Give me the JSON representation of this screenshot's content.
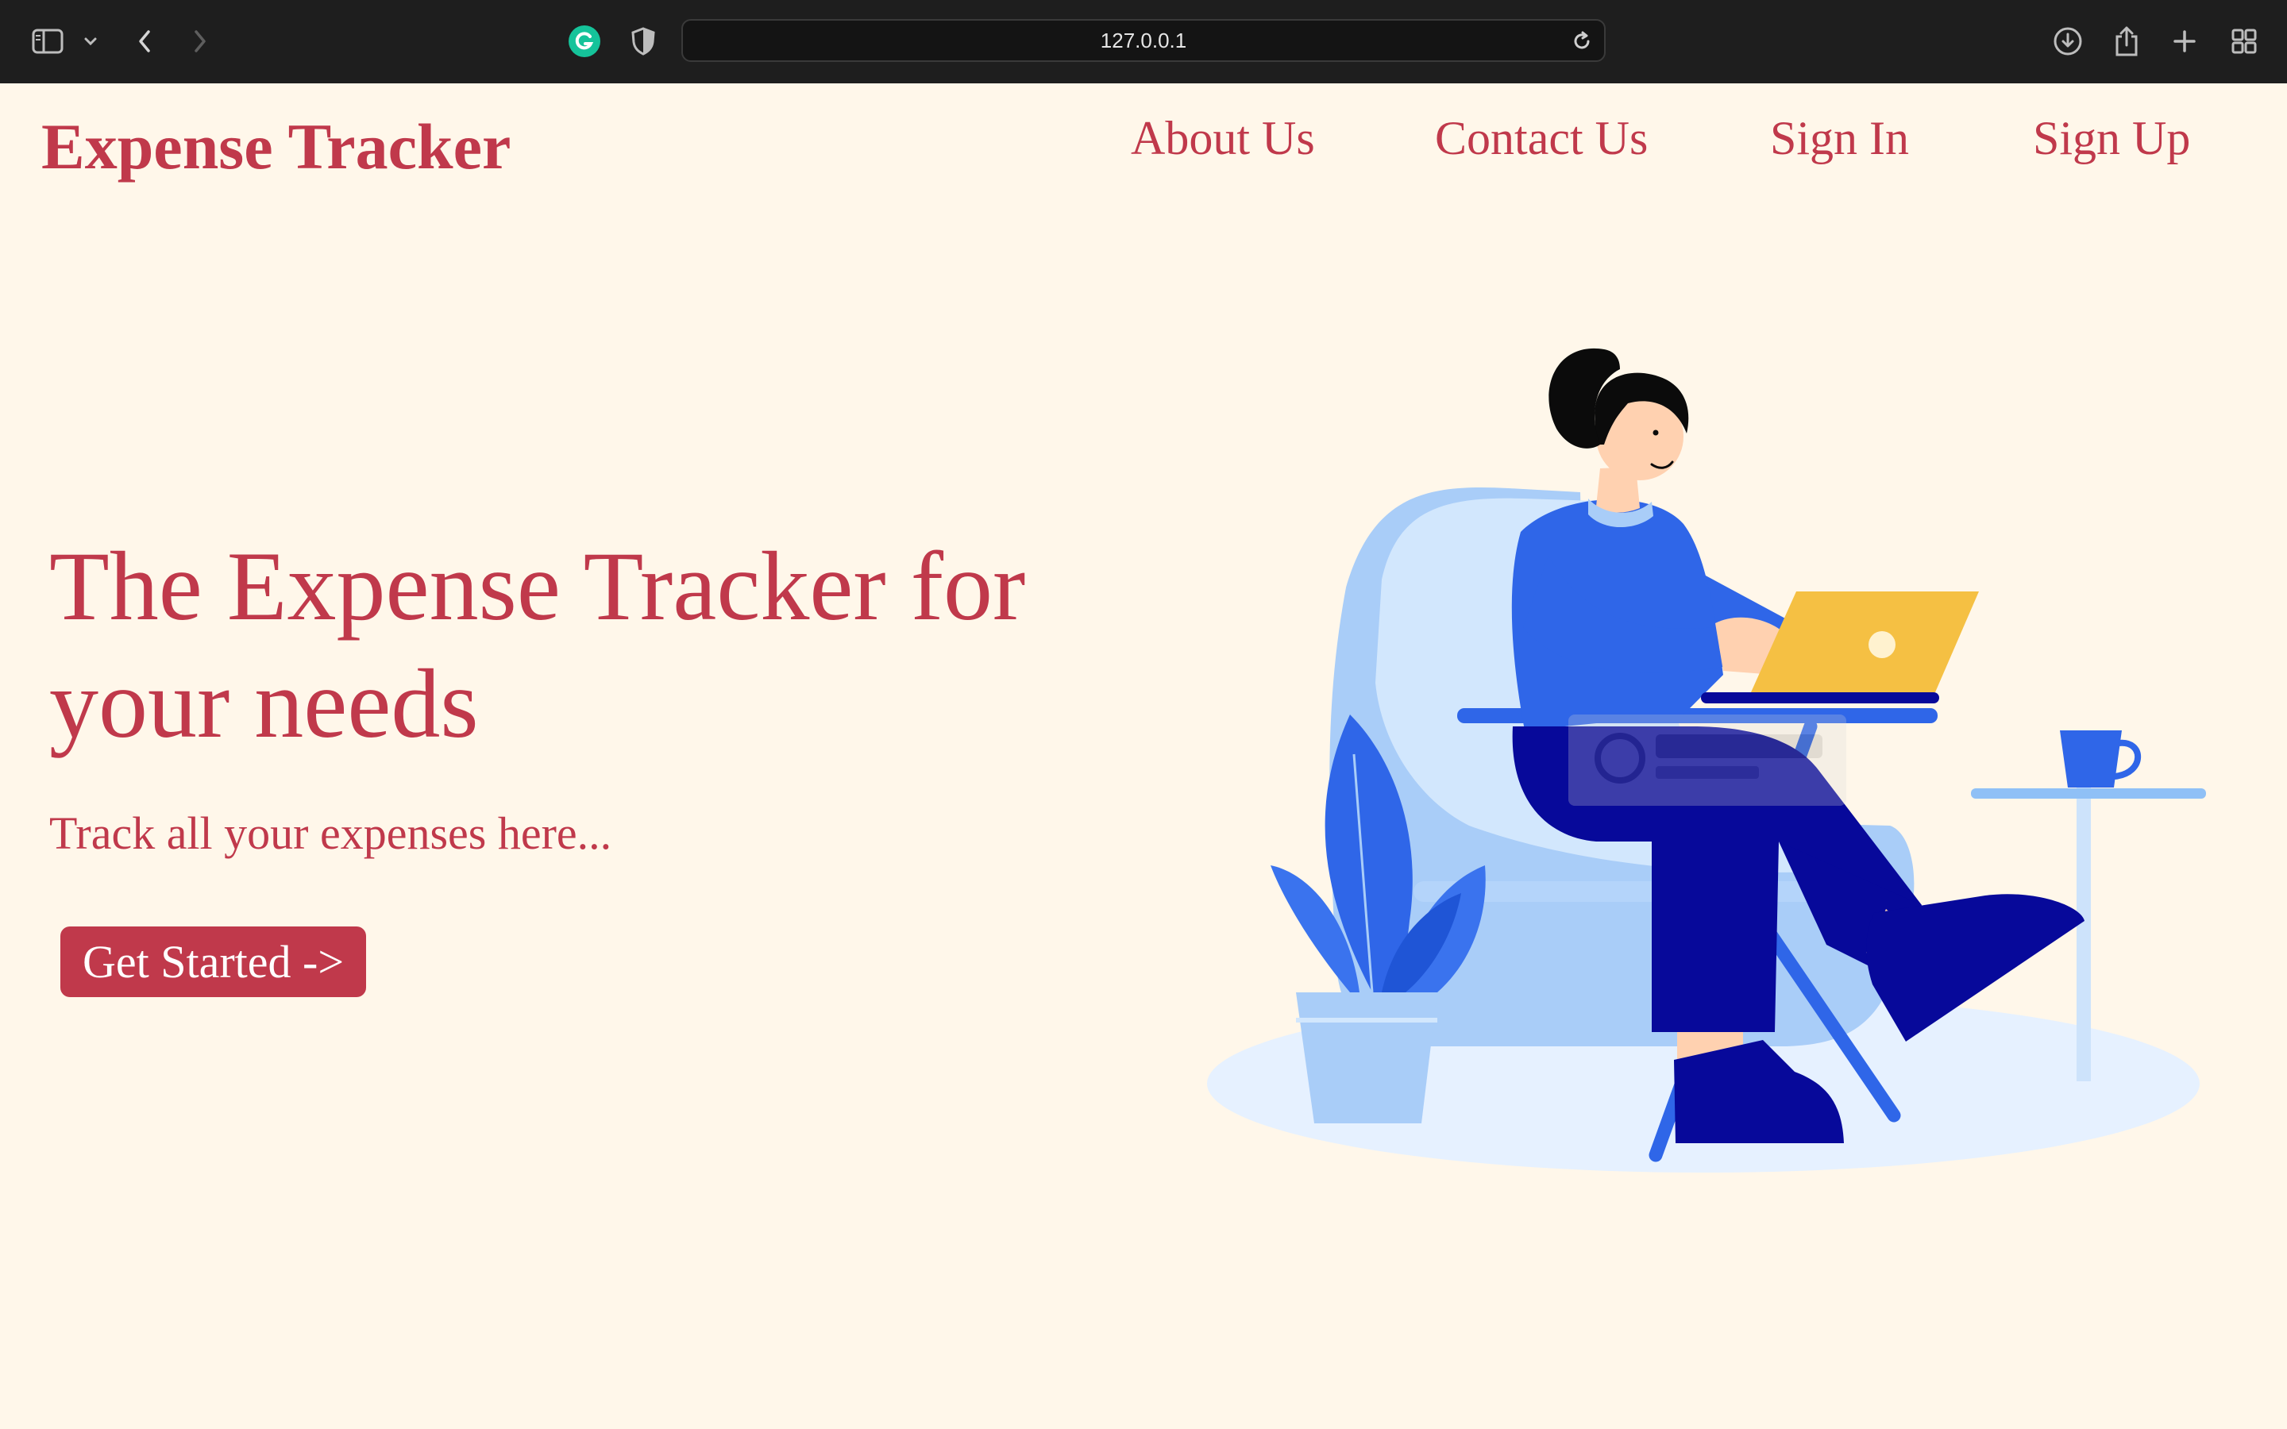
{
  "browser": {
    "url": "127.0.0.1",
    "icons": [
      "sidebar-icon",
      "chevron-down-icon",
      "back-icon",
      "forward-icon",
      "grammarly-icon",
      "shield-icon",
      "reload-icon",
      "download-icon",
      "share-icon",
      "new-tab-icon",
      "tab-overview-icon"
    ],
    "grammarly_color": "#15c39a"
  },
  "header": {
    "brand": "Expense Tracker",
    "nav": [
      "About Us",
      "Contact Us",
      "Sign In",
      "Sign Up"
    ]
  },
  "hero": {
    "title": "The Expense Tracker for your needs",
    "subtitle": "Track all your expenses here...",
    "cta_label": "Get Started ->"
  },
  "illustration": {
    "subject": "woman-with-laptop",
    "watermark_text": "Iconscout"
  },
  "colors": {
    "background": "#fff7ea",
    "accent": "#c0394b",
    "figure_primary": "#2f66e8",
    "figure_dark": "#07099a",
    "laptop": "#f5c043",
    "chair": "#a9cdf8"
  }
}
